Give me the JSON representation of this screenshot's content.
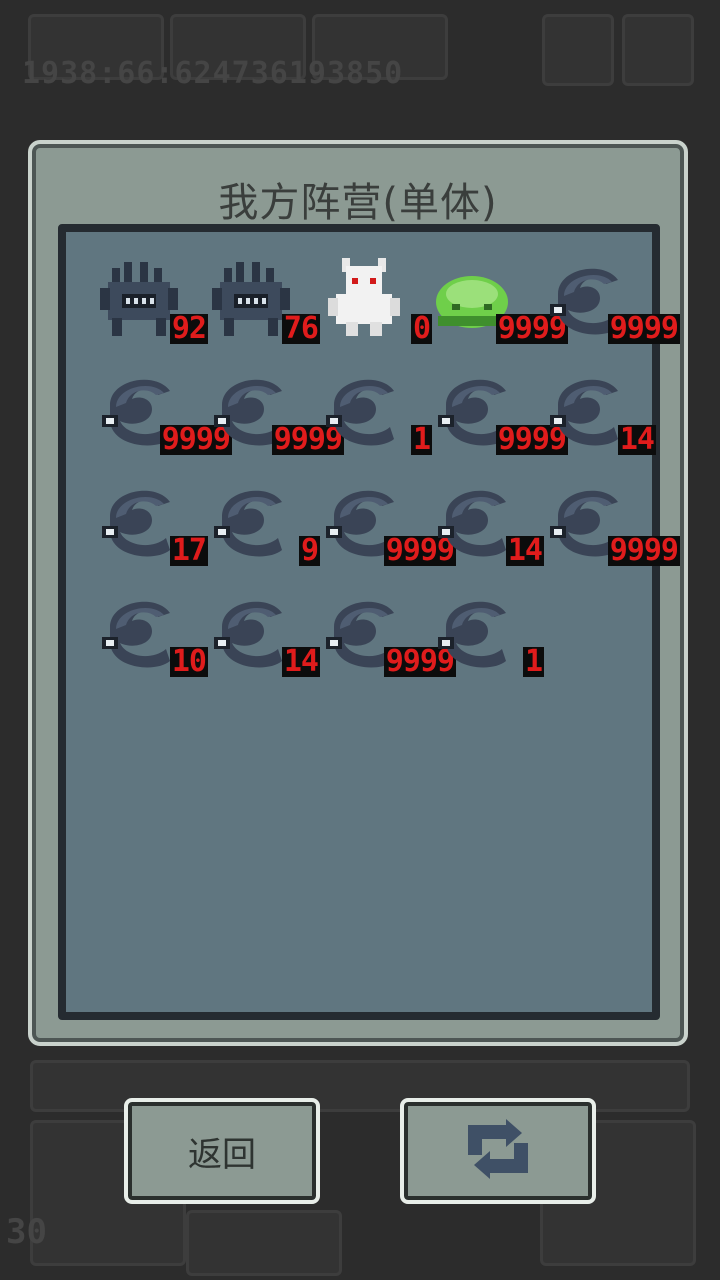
{
  "background": {
    "stats_text": "1938:66:624736193850",
    "turn_text": "30"
  },
  "dialog": {
    "title": "我方阵营(单体)"
  },
  "units": [
    {
      "type": "crab",
      "count": "92"
    },
    {
      "type": "crab",
      "count": "76"
    },
    {
      "type": "white-humanoid",
      "count": "0"
    },
    {
      "type": "green-slime",
      "count": "9999"
    },
    {
      "type": "shadow-wisp",
      "count": "9999"
    },
    {
      "type": "shadow-wisp",
      "count": "9999"
    },
    {
      "type": "shadow-wisp",
      "count": "9999"
    },
    {
      "type": "shadow-wisp",
      "count": "1"
    },
    {
      "type": "shadow-wisp",
      "count": "9999"
    },
    {
      "type": "shadow-wisp",
      "count": "14"
    },
    {
      "type": "shadow-wisp",
      "count": "17"
    },
    {
      "type": "shadow-wisp",
      "count": "9"
    },
    {
      "type": "shadow-wisp",
      "count": "9999"
    },
    {
      "type": "shadow-wisp",
      "count": "14"
    },
    {
      "type": "shadow-wisp",
      "count": "9999"
    },
    {
      "type": "shadow-wisp",
      "count": "10"
    },
    {
      "type": "shadow-wisp",
      "count": "14"
    },
    {
      "type": "shadow-wisp",
      "count": "9999"
    },
    {
      "type": "shadow-wisp",
      "count": "1"
    }
  ],
  "buttons": {
    "back_label": "返回",
    "switch_icon": "swap-arrows-icon"
  },
  "colors": {
    "count_text": "#e01c1c",
    "panel_bg": "#607680",
    "dialog_bg": "#8c9a93"
  }
}
